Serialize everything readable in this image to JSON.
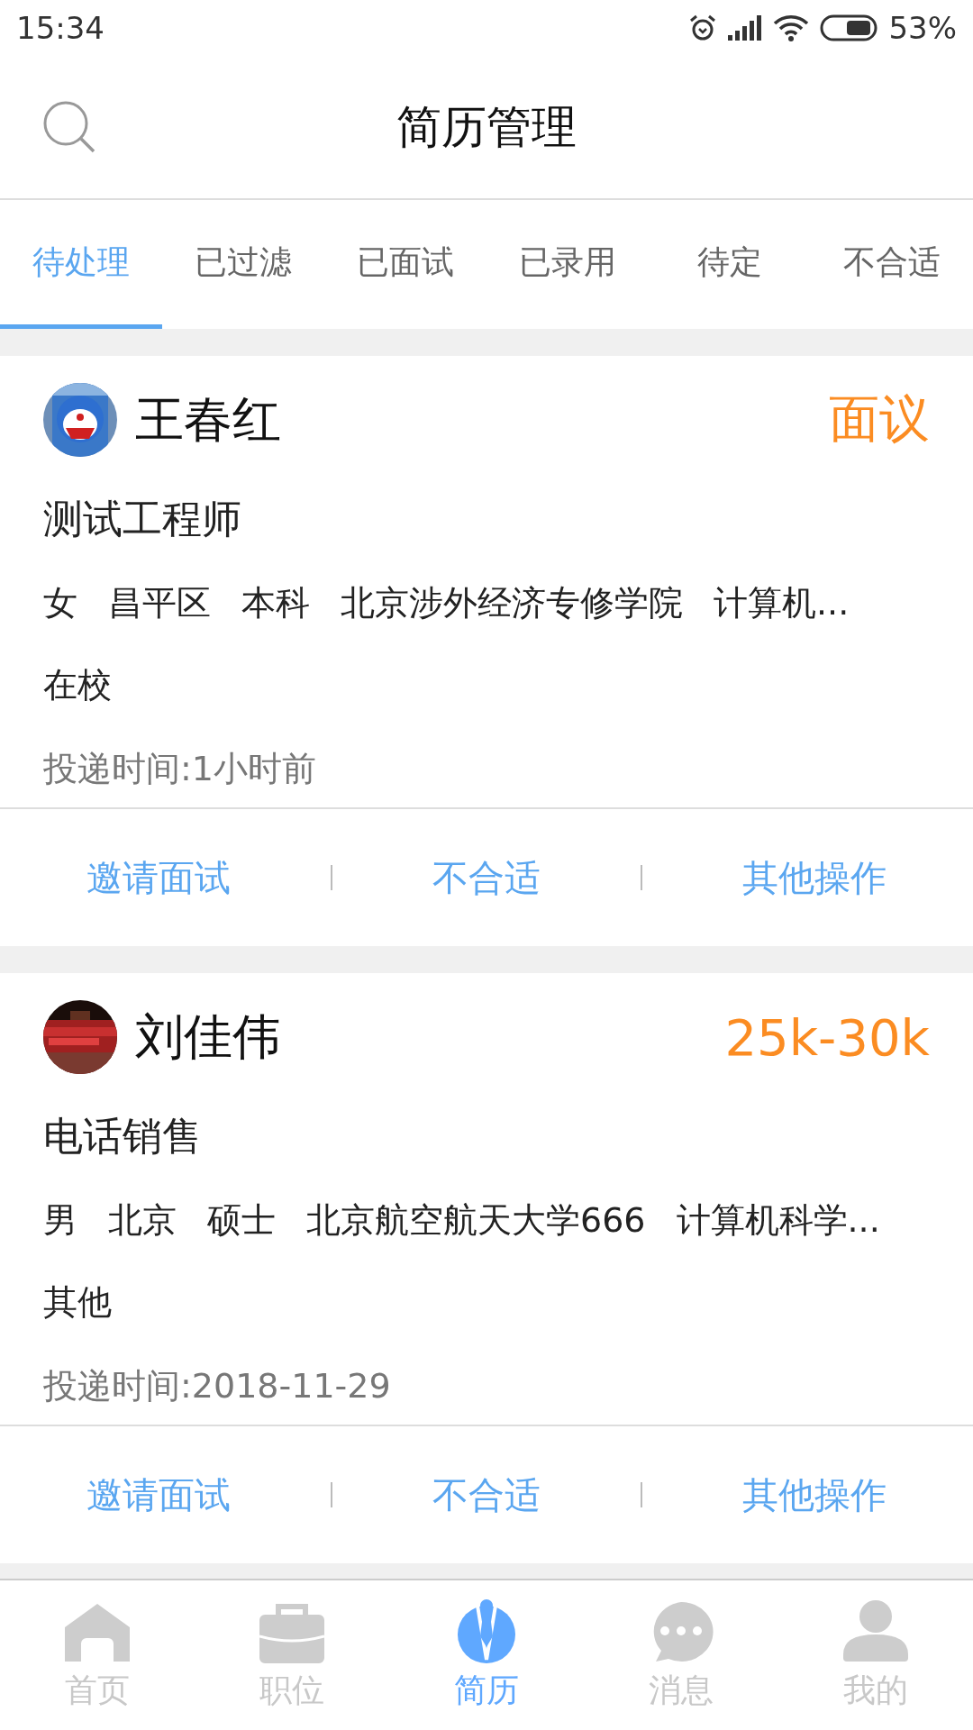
{
  "status_bar": {
    "time": "15:34",
    "battery": "53%"
  },
  "header": {
    "title": "简历管理"
  },
  "tabs": [
    {
      "label": "待处理",
      "selected": true
    },
    {
      "label": "已过滤",
      "selected": false
    },
    {
      "label": "已面试",
      "selected": false
    },
    {
      "label": "已录用",
      "selected": false
    },
    {
      "label": "待定",
      "selected": false
    },
    {
      "label": "不合适",
      "selected": false
    }
  ],
  "resumes": [
    {
      "name": "王春红",
      "salary": "面议",
      "position": "测试工程师",
      "tags": [
        "女",
        "昌平区",
        "本科",
        "北京涉外经济专修学院",
        "计算机..."
      ],
      "status": "在校",
      "delivered": "投递时间:1小时前",
      "avatar": {
        "kind": "picture"
      },
      "actions": [
        "邀请面试",
        "不合适",
        "其他操作"
      ]
    },
    {
      "name": "刘佳伟",
      "salary": "25k-30k",
      "position": "电话销售",
      "tags": [
        "男",
        "北京",
        "硕士",
        "北京航空航天大学666",
        "计算机科学..."
      ],
      "status": "其他",
      "delivered": "投递时间:2018-11-29",
      "avatar": {
        "kind": "picture"
      },
      "actions": [
        "邀请面试",
        "不合适",
        "其他操作"
      ]
    }
  ],
  "bottom_nav": [
    {
      "label": "首页",
      "selected": false
    },
    {
      "label": "职位",
      "selected": false
    },
    {
      "label": "简历",
      "selected": true
    },
    {
      "label": "消息",
      "selected": false
    },
    {
      "label": "我的",
      "selected": false
    }
  ]
}
